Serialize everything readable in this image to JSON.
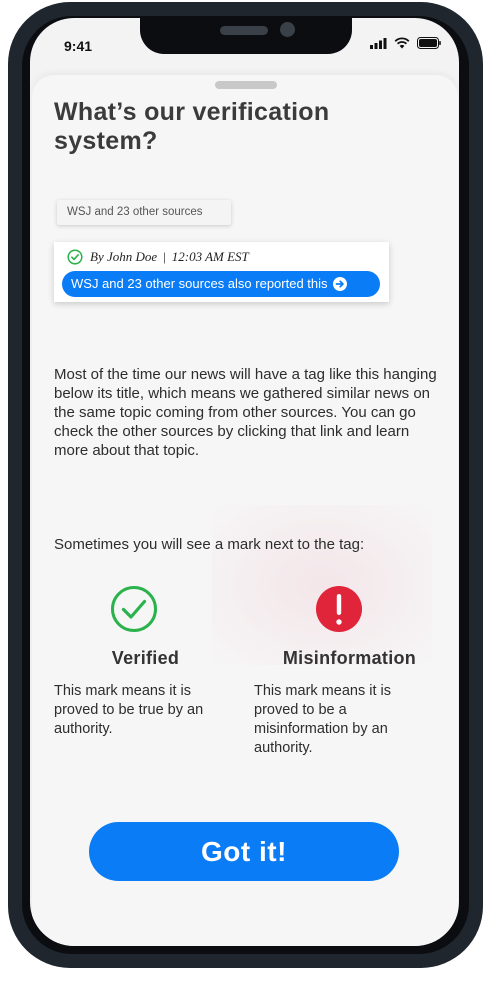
{
  "status_bar": {
    "time": "9:41"
  },
  "sheet": {
    "title": "What’s our verification system?",
    "source_chip": "WSJ and 23 other sources",
    "preview": {
      "author": "By John Doe",
      "separator": "|",
      "timestamp": "12:03 AM EST",
      "source_link": "WSJ and 23 other sources also reported this"
    },
    "paragraph": "Most of the time our news will have a tag like this hanging below its title, which means we gathered similar news on the same topic coming from other sources. You can go check the other sources by clicking that link and learn more about that topic.",
    "marks_intro": "Sometimes you will see a mark next to the tag:",
    "marks": [
      {
        "title": "Verified",
        "description": "This mark means it is proved to be true by an authority.",
        "color": "#2bb24c",
        "icon": "check-circle-icon"
      },
      {
        "title": "Misinformation",
        "description": "This mark means it is proved to be a misinformation by an authority.",
        "color": "#e0253a",
        "icon": "exclamation-circle-icon"
      }
    ],
    "cta_label": "Got it!"
  },
  "colors": {
    "accent": "#0a7cf5",
    "verified": "#2bb24c",
    "misinformation": "#e0253a"
  }
}
